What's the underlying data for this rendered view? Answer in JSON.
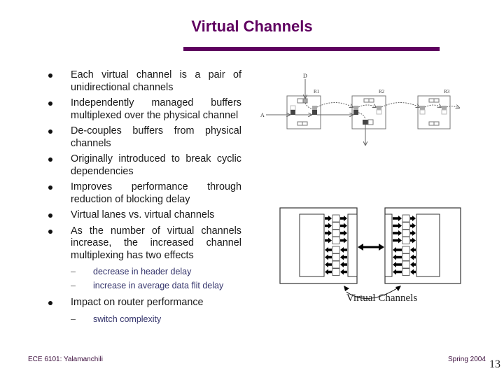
{
  "slide": {
    "title": "Virtual Channels",
    "bullets": [
      {
        "text": "Each virtual channel is a pair of unidirectional channels"
      },
      {
        "text": "Independently managed buffers multiplexed over the physical channel"
      },
      {
        "text": "De-couples buffers from physical channels"
      },
      {
        "text": "Originally introduced to break cyclic dependencies"
      },
      {
        "text": "Improves performance through reduction of blocking delay"
      },
      {
        "text": "Virtual lanes vs. virtual channels"
      },
      {
        "text": "As the number of virtual channels increase, the increased channel multiplexing has two effects",
        "sub": [
          "decrease in header delay",
          "increase in average data flit delay"
        ]
      },
      {
        "text": "Impact on router performance",
        "sub": [
          "switch complexity"
        ]
      }
    ],
    "sub_marker": "–"
  },
  "figures": {
    "router_chain": {
      "source_labels": [
        "D",
        "A"
      ],
      "router_labels": [
        "R1",
        "R2",
        "R3"
      ]
    },
    "virtual_channels": {
      "caption": "Virtual Channels"
    }
  },
  "footer": {
    "course": "ECE 6101: Yalamanchili",
    "term": "Spring 2004",
    "page_number": "13"
  },
  "colors": {
    "title": "#5f0060",
    "sub_bullet_text": "#33336b",
    "footer_text": "#3a0b3b"
  }
}
